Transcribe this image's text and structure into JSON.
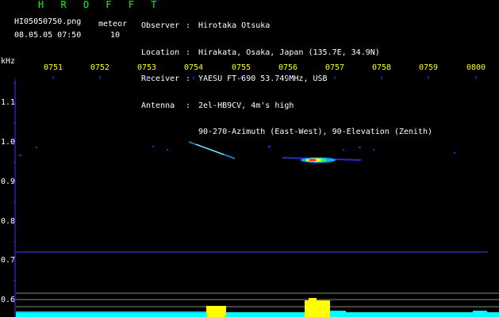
{
  "app": {
    "brand": "H R O F F T",
    "filename": "HI05050750.png",
    "datetime": "08.05.05 07:50",
    "meteor_label": "meteor",
    "meteor_count": "10"
  },
  "info": [
    {
      "label": "Observer",
      "value": "Hirotaka Otsuka"
    },
    {
      "label": "Location",
      "value": "Hirakata, Osaka, Japan (135.7E, 34.9N)"
    },
    {
      "label": "Receiver",
      "value": "YAESU FT-690 53.749MHz, USB"
    },
    {
      "label": "Antenna",
      "value": "2el-HB9CV, 4m's high"
    },
    {
      "label": "",
      "value": "90-270-Azimuth (East-West), 90-Elevation (Zenith)"
    }
  ],
  "axis": {
    "unit": "kHz",
    "time_ticks": [
      "0751",
      "0752",
      "0753",
      "0754",
      "0755",
      "0756",
      "0757",
      "0758",
      "0759",
      "0800"
    ],
    "freq_ticks": [
      "1.1",
      "1.0",
      "0.9",
      "0.8",
      "0.7",
      "0.6"
    ]
  },
  "colors": {
    "brand": "#00ff00",
    "tick_label": "#ffff00",
    "axis": "#3a3aff",
    "noise": "#00ffff",
    "burst": "#ffff00",
    "trail": "#00ccff"
  }
}
